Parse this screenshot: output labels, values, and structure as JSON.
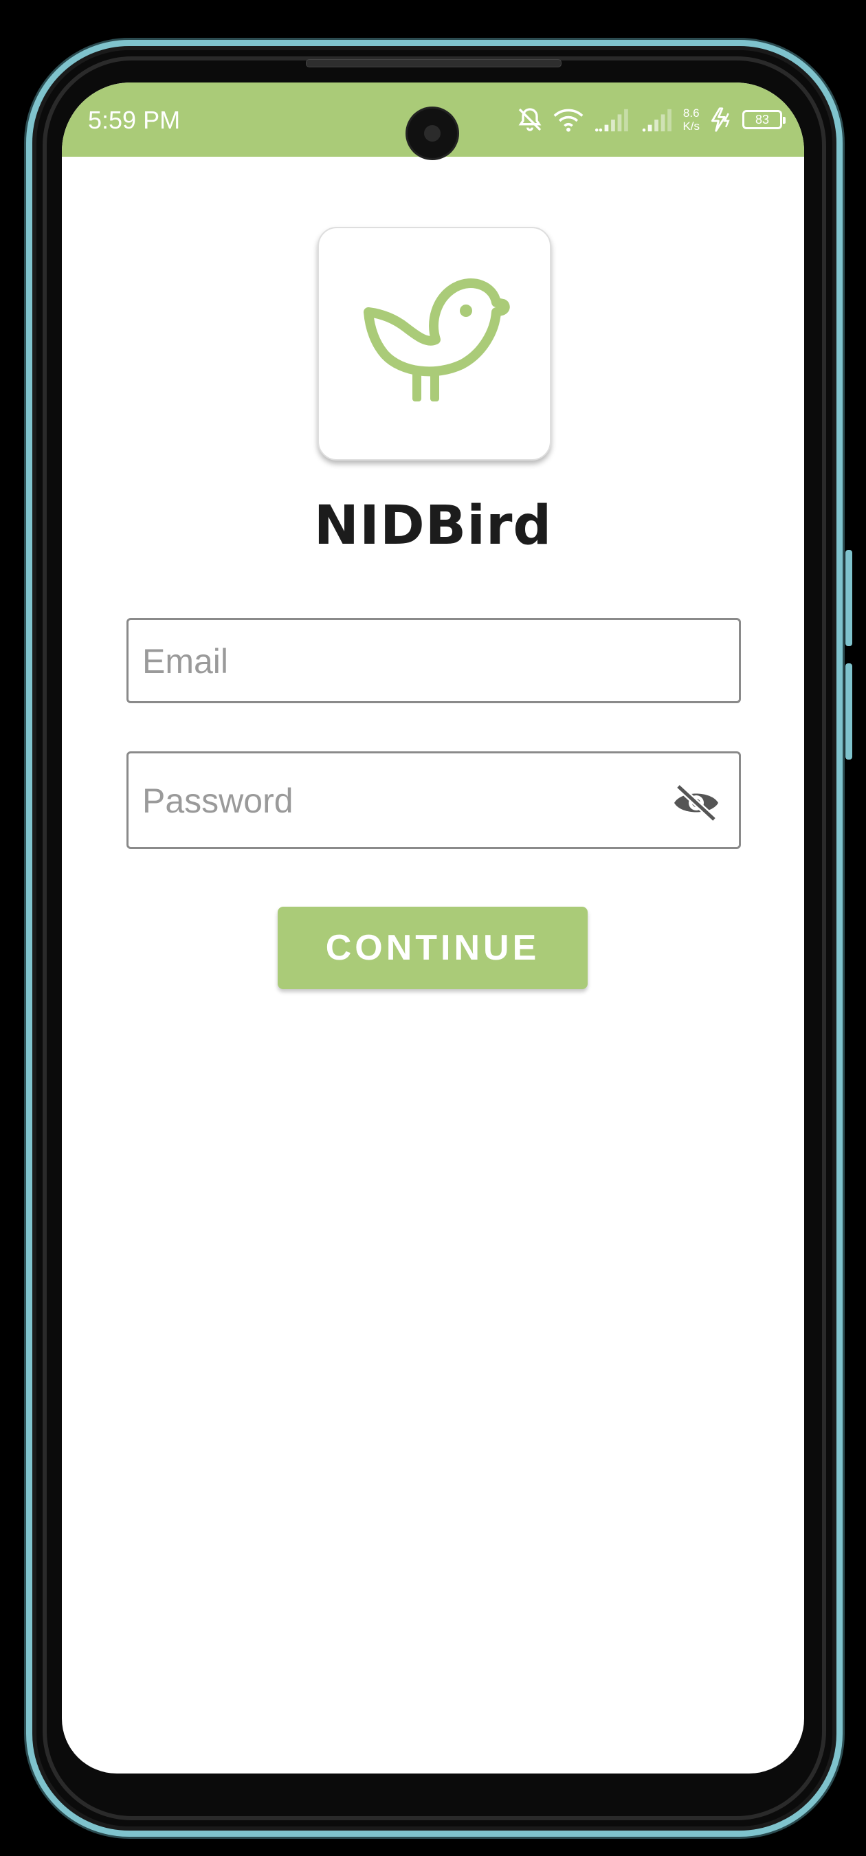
{
  "theme": {
    "accent": "#aacb78",
    "title_color": "#1c1c1c",
    "frame_color": "#7fc3cd"
  },
  "status_bar": {
    "time": "5:59 PM",
    "net_speed_value": "8.6",
    "net_speed_unit": "K/s",
    "battery_level": "83",
    "icons": [
      "bell-off-icon",
      "wifi-icon",
      "signal-icon",
      "signal-icon",
      "charging-icon",
      "battery-icon"
    ]
  },
  "app": {
    "logo_icon": "bird-icon",
    "title": "NIDBird"
  },
  "form": {
    "email": {
      "placeholder": "Email",
      "value": ""
    },
    "password": {
      "placeholder": "Password",
      "value": "",
      "toggle_icon": "eye-off-icon"
    },
    "submit_label": "CONTINUE"
  }
}
